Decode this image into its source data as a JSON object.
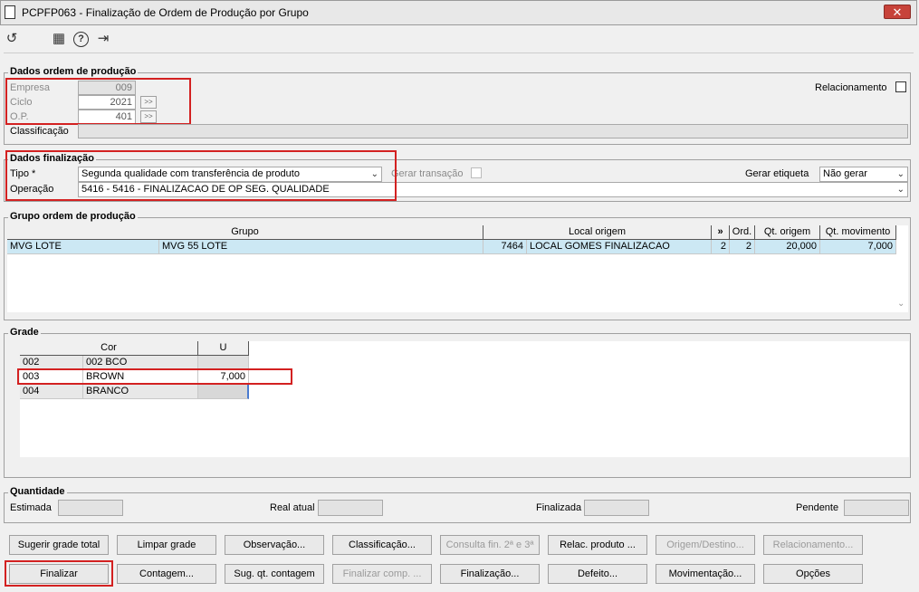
{
  "window": {
    "title": "PCPFP063 - Finalização de Ordem de Produção por Grupo",
    "close": "✕"
  },
  "toolbar": {
    "refresh": "↺",
    "calendar": "▦",
    "help": "?",
    "exit": "⇥"
  },
  "dados_ordem": {
    "title": "Dados ordem de produção",
    "empresa_label": "Empresa",
    "empresa_value": "009",
    "ciclo_label": "Ciclo",
    "ciclo_value": "2021",
    "op_label": "O.P.",
    "op_value": "401",
    "classificacao_label": "Classificação",
    "classificacao_value": "",
    "relacionamento_label": "Relacionamento"
  },
  "dados_finalizacao": {
    "title": "Dados finalização",
    "tipo_label": "Tipo *",
    "tipo_value": "Segunda qualidade com transferência de produto",
    "gerar_transacao_label": "Gerar transação",
    "gerar_etiqueta_label": "Gerar etiqueta",
    "gerar_etiqueta_value": "Não gerar",
    "operacao_label": "Operação",
    "operacao_value": "5416 - 5416 - FINALIZACAO DE OP SEG. QUALIDADE"
  },
  "grupo_ordem": {
    "title": "Grupo ordem de produção",
    "headers": {
      "grupo": "Grupo",
      "local_origem": "Local origem",
      "more": "»",
      "ord": "Ord.",
      "qt_origem": "Qt. origem",
      "qt_movimento": "Qt. movimento"
    },
    "rows": [
      {
        "grupo_code": "MVG LOTE",
        "grupo_desc": "MVG 55 LOTE",
        "local_code": "7464",
        "local_desc": "LOCAL GOMES FINALIZACAO",
        "more": "2",
        "ord": "2",
        "qt_origem": "20,000",
        "qt_movimento": "7,000"
      }
    ]
  },
  "grade": {
    "title": "Grade",
    "headers": {
      "cor": "Cor",
      "u": "U"
    },
    "rows": [
      {
        "code": "002",
        "cor": "002 BCO",
        "u": ""
      },
      {
        "code": "003",
        "cor": "BROWN",
        "u": "7,000"
      },
      {
        "code": "004",
        "cor": "BRANCO",
        "u": ""
      }
    ]
  },
  "quantidade": {
    "title": "Quantidade",
    "estimada_label": "Estimada",
    "real_atual_label": "Real atual",
    "finalizada_label": "Finalizada",
    "pendente_label": "Pendente"
  },
  "buttons_row1": [
    {
      "label": "Sugerir grade total",
      "enabled": true
    },
    {
      "label": "Limpar grade",
      "enabled": true
    },
    {
      "label": "Observação...",
      "enabled": true
    },
    {
      "label": "Classificação...",
      "enabled": true
    },
    {
      "label": "Consulta fin. 2ª e 3ª",
      "enabled": false
    },
    {
      "label": "Relac. produto ...",
      "enabled": true
    },
    {
      "label": "Origem/Destino...",
      "enabled": false
    },
    {
      "label": "Relacionamento...",
      "enabled": false
    }
  ],
  "buttons_row2": [
    {
      "label": "Finalizar",
      "enabled": true
    },
    {
      "label": "Contagem...",
      "enabled": true
    },
    {
      "label": "Sug. qt. contagem",
      "enabled": true
    },
    {
      "label": "Finalizar comp. ...",
      "enabled": false
    },
    {
      "label": "Finalização...",
      "enabled": true
    },
    {
      "label": "Defeito...",
      "enabled": true
    },
    {
      "label": "Movimentação...",
      "enabled": true
    },
    {
      "label": "Opções",
      "enabled": true
    }
  ],
  "colors": {
    "selected_row": "#cce8f4",
    "highlight": "#d32121"
  }
}
